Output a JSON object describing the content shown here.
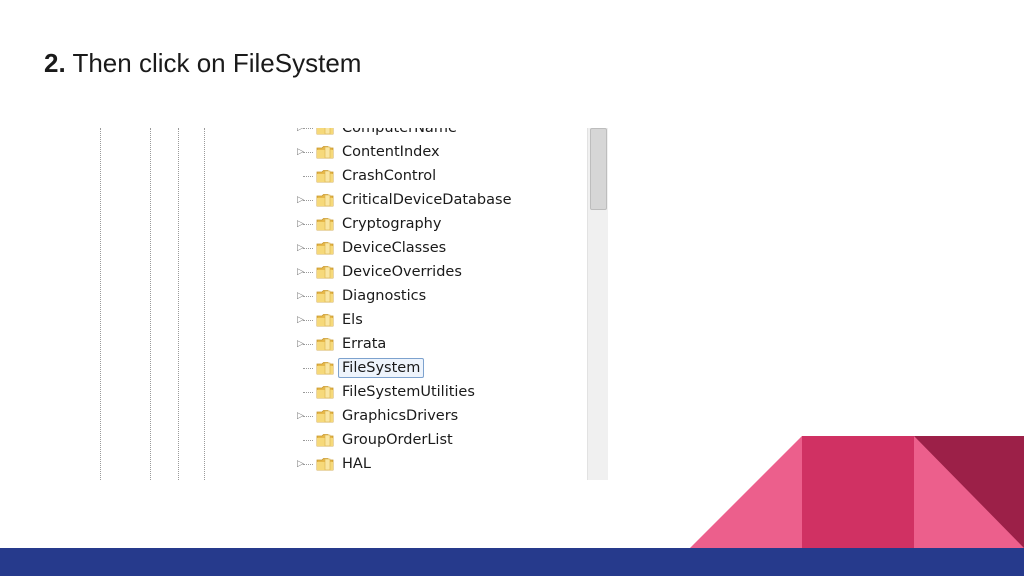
{
  "slide": {
    "step_number": "2.",
    "instruction": "Then click on FileSystem"
  },
  "registry_tree": {
    "items": [
      {
        "label": "ComputerName",
        "expandable": true,
        "selected": false
      },
      {
        "label": "ContentIndex",
        "expandable": true,
        "selected": false
      },
      {
        "label": "CrashControl",
        "expandable": false,
        "selected": false
      },
      {
        "label": "CriticalDeviceDatabase",
        "expandable": true,
        "selected": false
      },
      {
        "label": "Cryptography",
        "expandable": true,
        "selected": false
      },
      {
        "label": "DeviceClasses",
        "expandable": true,
        "selected": false
      },
      {
        "label": "DeviceOverrides",
        "expandable": true,
        "selected": false
      },
      {
        "label": "Diagnostics",
        "expandable": true,
        "selected": false
      },
      {
        "label": "Els",
        "expandable": true,
        "selected": false
      },
      {
        "label": "Errata",
        "expandable": true,
        "selected": false
      },
      {
        "label": "FileSystem",
        "expandable": false,
        "selected": true
      },
      {
        "label": "FileSystemUtilities",
        "expandable": false,
        "selected": false
      },
      {
        "label": "GraphicsDrivers",
        "expandable": true,
        "selected": false
      },
      {
        "label": "GroupOrderList",
        "expandable": false,
        "selected": false
      },
      {
        "label": "HAL",
        "expandable": true,
        "selected": false
      }
    ]
  },
  "icons": {
    "folder": "folder-icon",
    "expander": "expand-arrow-icon"
  },
  "colors": {
    "title_text": "#1a1a1a",
    "selection_border": "#7da2ce",
    "folder_yellow": "#f2c75c",
    "accent_pink": "#ec5f8c",
    "accent_magenta": "#d03163",
    "accent_maroon": "#9c2048",
    "footer_navy": "#263a8c"
  }
}
